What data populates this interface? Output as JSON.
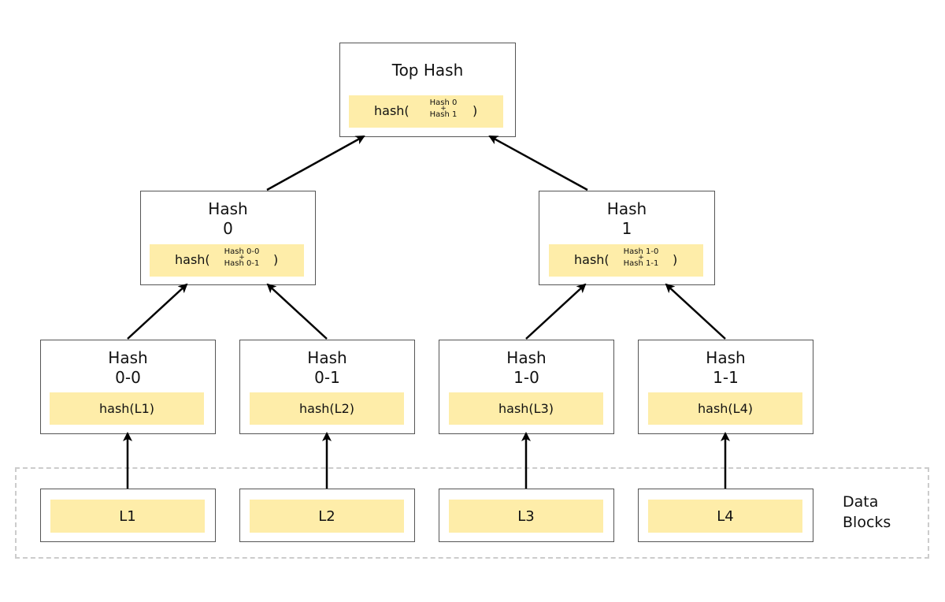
{
  "diagram": {
    "type": "merkle-tree",
    "top": {
      "title": "Top Hash",
      "fn": "hash(",
      "inputs": [
        "Hash 0",
        "+",
        "Hash 1"
      ],
      "close": ")"
    },
    "level1": [
      {
        "title_line1": "Hash",
        "title_line2": "0",
        "fn": "hash(",
        "inputs": [
          "Hash 0-0",
          "+",
          "Hash 0-1"
        ],
        "close": ")"
      },
      {
        "title_line1": "Hash",
        "title_line2": "1",
        "fn": "hash(",
        "inputs": [
          "Hash 1-0",
          "+",
          "Hash 1-1"
        ],
        "close": ")"
      }
    ],
    "leaves": [
      {
        "title_line1": "Hash",
        "title_line2": "0-0",
        "content": "hash(L1)"
      },
      {
        "title_line1": "Hash",
        "title_line2": "0-1",
        "content": "hash(L2)"
      },
      {
        "title_line1": "Hash",
        "title_line2": "1-0",
        "content": "hash(L3)"
      },
      {
        "title_line1": "Hash",
        "title_line2": "1-1",
        "content": "hash(L4)"
      }
    ],
    "data_blocks": {
      "label_line1": "Data",
      "label_line2": "Blocks",
      "blocks": [
        "L1",
        "L2",
        "L3",
        "L4"
      ]
    },
    "edges": [
      [
        "Hash 0",
        "Top Hash"
      ],
      [
        "Hash 1",
        "Top Hash"
      ],
      [
        "Hash 0-0",
        "Hash 0"
      ],
      [
        "Hash 0-1",
        "Hash 0"
      ],
      [
        "Hash 1-0",
        "Hash 1"
      ],
      [
        "Hash 1-1",
        "Hash 1"
      ],
      [
        "L1",
        "Hash 0-0"
      ],
      [
        "L2",
        "Hash 0-1"
      ],
      [
        "L3",
        "Hash 1-0"
      ],
      [
        "L4",
        "Hash 1-1"
      ]
    ],
    "colors": {
      "fill": "#feeda9",
      "border": "#555555",
      "dashed": "#cccccc",
      "arrow": "#000000"
    }
  }
}
